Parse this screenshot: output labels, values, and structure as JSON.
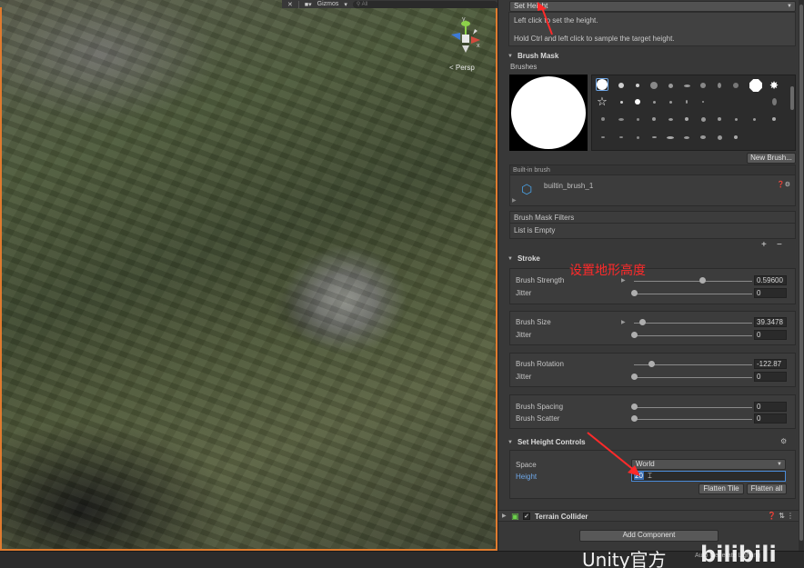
{
  "scene": {
    "gizmos_label": "Gizmos",
    "search_placeholder": "All",
    "camera_label": "< Persp",
    "gizmo_y": "y",
    "gizmo_x": "x"
  },
  "inspector": {
    "tool_dropdown": "Set Height",
    "help_line1": "Left click to set the height.",
    "help_line2": "Hold Ctrl and left click to sample the target height.",
    "brush_mask_title": "Brush Mask",
    "brushes_label": "Brushes",
    "new_brush_button": "New Brush...",
    "builtin_brush_header": "Built-in brush",
    "builtin_brush_name": "builtin_brush_1",
    "mask_filters_title": "Brush Mask Filters",
    "list_empty": "List is Empty",
    "add_symbol": "+",
    "remove_symbol": "−",
    "stroke_title": "Stroke",
    "brush_strength_label": "Brush Strength",
    "brush_strength_value": "0.59600",
    "strength_jitter_label": "Jitter",
    "strength_jitter_value": "0",
    "brush_size_label": "Brush Size",
    "brush_size_value": "39.3478",
    "size_jitter_label": "Jitter",
    "size_jitter_value": "0",
    "brush_rotation_label": "Brush Rotation",
    "brush_rotation_value": "-122.87",
    "rotation_jitter_label": "Jitter",
    "rotation_jitter_value": "0",
    "brush_spacing_label": "Brush Spacing",
    "brush_spacing_value": "0",
    "brush_scatter_label": "Brush Scatter",
    "brush_scatter_value": "0",
    "set_height_title": "Set Height Controls",
    "space_label": "Space",
    "space_value": "World",
    "height_label": "Height",
    "height_value": "20",
    "flatten_tile_button": "Flatten Tile",
    "flatten_all_button": "Flatten all",
    "terrain_collider_label": "Terrain Collider",
    "add_component_button": "Add Component"
  },
  "slider_levels": {
    "brush_strength": 0.596,
    "brush_size": 0.1,
    "brush_rotation": 0.16,
    "brush_spacing": 0,
    "brush_scatter": 0,
    "jitters": 0
  },
  "annotation": {
    "text": "设置地形高度",
    "color": "#ff2a2a"
  },
  "watermark": {
    "text": "Unity官方",
    "bili": "bilibili",
    "autogen": "Auto Generate Lighting"
  },
  "colors": {
    "scene_border": "#e07b2f",
    "inspector_bg": "#383838",
    "height_label": "#6fa8e8"
  }
}
